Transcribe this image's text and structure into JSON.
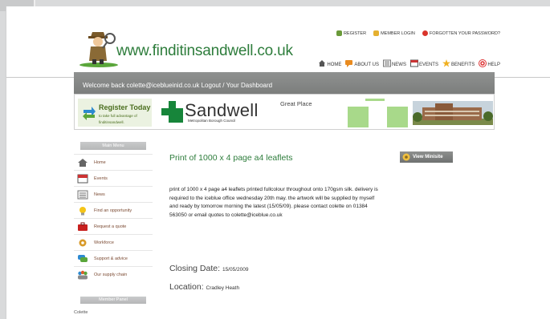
{
  "header": {
    "logo_text": "www.finditinsandwell.co.uk",
    "top_links": [
      {
        "label": "REGISTER",
        "icon": "register-icon",
        "color": "#6a9a3a"
      },
      {
        "label": "MEMBER LOGIN",
        "icon": "lock-icon",
        "color": "#e5b030"
      },
      {
        "label": "FORGOTTEN YOUR PASSWORD?",
        "icon": "forgotten-icon",
        "color": "#d9342b"
      }
    ],
    "nav": [
      {
        "label": "HOME",
        "icon": "home-icon"
      },
      {
        "label": "ABOUT US",
        "icon": "chat-icon"
      },
      {
        "label": "NEWS",
        "icon": "news-icon"
      },
      {
        "label": "EVENTS",
        "icon": "calendar-icon"
      },
      {
        "label": "BENEFITS",
        "icon": "star-icon"
      },
      {
        "label": "HELP",
        "icon": "help-icon"
      }
    ]
  },
  "welcome": {
    "text": "Welcome back colette@iceblueinid.co.uk Logout / Your Dashboard"
  },
  "banner": {
    "register_title": "Register Today",
    "register_sub": "to take full advantage of finditinsandwell.",
    "sandwell_name": "Sandwell",
    "sandwell_sub": "Metropolitan Borough Council",
    "tagline": "Great Place"
  },
  "sidebar": {
    "main_menu_label": "Main Menu",
    "items": [
      {
        "label": "Home",
        "icon": "home-icon"
      },
      {
        "label": "Events",
        "icon": "calendar-icon"
      },
      {
        "label": "News",
        "icon": "news-icon"
      },
      {
        "label": "Find an opportunity",
        "icon": "lightbulb-icon"
      },
      {
        "label": "Request a quote",
        "icon": "briefcase-icon"
      },
      {
        "label": "Workforce",
        "icon": "gear-icon"
      },
      {
        "label": "Support & advice",
        "icon": "speech-bubble-icon"
      },
      {
        "label": "Our supply chain",
        "icon": "people-icon"
      }
    ],
    "member_panel_label": "Member Panel",
    "member_name": "Colette"
  },
  "content": {
    "title": "Print of 1000 x 4 page a4 leaflets",
    "view_minisite_label": "View Minisite",
    "description": "print of 1000 x 4 page a4 leaflets printed fullcolour throughout onto 170gsm silk. delivery is required to the iceblue office wednesday 20th may. the artwork will be supplied by myself and ready by tomorrow morning the latest (15/05/09). please contact colette on 01384 563050 or email quotes to colette@iceblue.co.uk",
    "closing_label": "Closing Date:",
    "closing_value": "15/05/2009",
    "location_label": "Location:",
    "location_value": "Cradley Heath"
  },
  "colors": {
    "brand_green": "#2e7d3c",
    "menu_text": "#7b4a32",
    "bar_grey": "#858786"
  }
}
